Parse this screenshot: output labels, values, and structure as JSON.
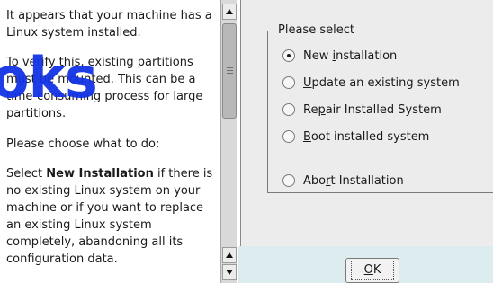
{
  "help": {
    "p1": "It appears that your machine has a Linux system installed.",
    "p2": "To verify this, existing partitions must be mounted. This can be a time-consuming process for large partitions.",
    "p3": "Please choose what to do:",
    "p4_pre": "Select ",
    "p4_bold": "New Installation",
    "p4_post": " if there is no existing Linux system on your machine or if you want to replace an existing Linux system completely, abandoning all its configuration data."
  },
  "watermark": "oks",
  "options": {
    "legend": "Please select",
    "items": [
      {
        "pre": "New ",
        "u": "i",
        "post": "nstallation",
        "checked": true
      },
      {
        "pre": "",
        "u": "U",
        "post": "pdate an existing system",
        "checked": false
      },
      {
        "pre": "Re",
        "u": "p",
        "post": "air Installed System",
        "checked": false
      },
      {
        "pre": "",
        "u": "B",
        "post": "oot installed system",
        "checked": false
      },
      {
        "pre": "Abo",
        "u": "r",
        "post": "t Installation",
        "checked": false
      }
    ]
  },
  "ok_button": {
    "pre": "",
    "u": "O",
    "post": "K"
  }
}
